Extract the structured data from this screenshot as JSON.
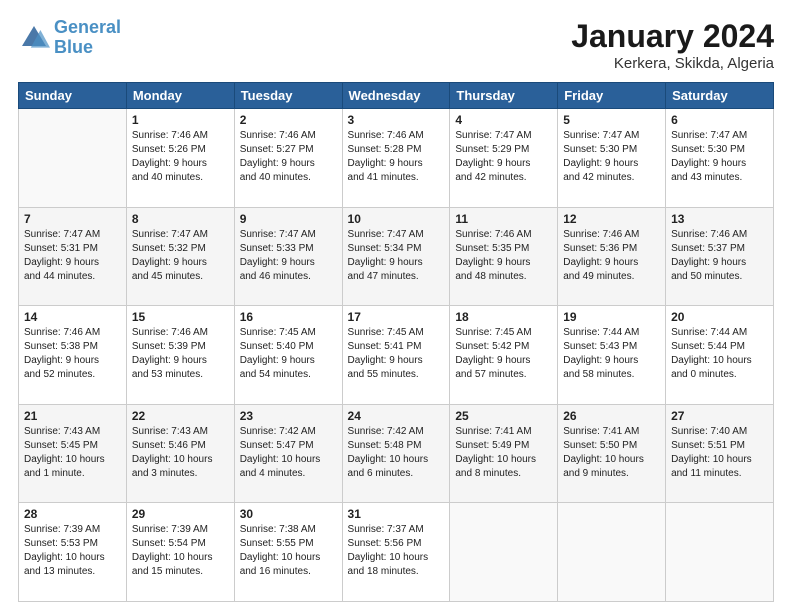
{
  "header": {
    "logo_line1": "General",
    "logo_line2": "Blue",
    "main_title": "January 2024",
    "subtitle": "Kerkera, Skikda, Algeria"
  },
  "days_of_week": [
    "Sunday",
    "Monday",
    "Tuesday",
    "Wednesday",
    "Thursday",
    "Friday",
    "Saturday"
  ],
  "weeks": [
    [
      {
        "day": "",
        "info": ""
      },
      {
        "day": "1",
        "info": "Sunrise: 7:46 AM\nSunset: 5:26 PM\nDaylight: 9 hours\nand 40 minutes."
      },
      {
        "day": "2",
        "info": "Sunrise: 7:46 AM\nSunset: 5:27 PM\nDaylight: 9 hours\nand 40 minutes."
      },
      {
        "day": "3",
        "info": "Sunrise: 7:46 AM\nSunset: 5:28 PM\nDaylight: 9 hours\nand 41 minutes."
      },
      {
        "day": "4",
        "info": "Sunrise: 7:47 AM\nSunset: 5:29 PM\nDaylight: 9 hours\nand 42 minutes."
      },
      {
        "day": "5",
        "info": "Sunrise: 7:47 AM\nSunset: 5:30 PM\nDaylight: 9 hours\nand 42 minutes."
      },
      {
        "day": "6",
        "info": "Sunrise: 7:47 AM\nSunset: 5:30 PM\nDaylight: 9 hours\nand 43 minutes."
      }
    ],
    [
      {
        "day": "7",
        "info": "Sunrise: 7:47 AM\nSunset: 5:31 PM\nDaylight: 9 hours\nand 44 minutes."
      },
      {
        "day": "8",
        "info": "Sunrise: 7:47 AM\nSunset: 5:32 PM\nDaylight: 9 hours\nand 45 minutes."
      },
      {
        "day": "9",
        "info": "Sunrise: 7:47 AM\nSunset: 5:33 PM\nDaylight: 9 hours\nand 46 minutes."
      },
      {
        "day": "10",
        "info": "Sunrise: 7:47 AM\nSunset: 5:34 PM\nDaylight: 9 hours\nand 47 minutes."
      },
      {
        "day": "11",
        "info": "Sunrise: 7:46 AM\nSunset: 5:35 PM\nDaylight: 9 hours\nand 48 minutes."
      },
      {
        "day": "12",
        "info": "Sunrise: 7:46 AM\nSunset: 5:36 PM\nDaylight: 9 hours\nand 49 minutes."
      },
      {
        "day": "13",
        "info": "Sunrise: 7:46 AM\nSunset: 5:37 PM\nDaylight: 9 hours\nand 50 minutes."
      }
    ],
    [
      {
        "day": "14",
        "info": "Sunrise: 7:46 AM\nSunset: 5:38 PM\nDaylight: 9 hours\nand 52 minutes."
      },
      {
        "day": "15",
        "info": "Sunrise: 7:46 AM\nSunset: 5:39 PM\nDaylight: 9 hours\nand 53 minutes."
      },
      {
        "day": "16",
        "info": "Sunrise: 7:45 AM\nSunset: 5:40 PM\nDaylight: 9 hours\nand 54 minutes."
      },
      {
        "day": "17",
        "info": "Sunrise: 7:45 AM\nSunset: 5:41 PM\nDaylight: 9 hours\nand 55 minutes."
      },
      {
        "day": "18",
        "info": "Sunrise: 7:45 AM\nSunset: 5:42 PM\nDaylight: 9 hours\nand 57 minutes."
      },
      {
        "day": "19",
        "info": "Sunrise: 7:44 AM\nSunset: 5:43 PM\nDaylight: 9 hours\nand 58 minutes."
      },
      {
        "day": "20",
        "info": "Sunrise: 7:44 AM\nSunset: 5:44 PM\nDaylight: 10 hours\nand 0 minutes."
      }
    ],
    [
      {
        "day": "21",
        "info": "Sunrise: 7:43 AM\nSunset: 5:45 PM\nDaylight: 10 hours\nand 1 minute."
      },
      {
        "day": "22",
        "info": "Sunrise: 7:43 AM\nSunset: 5:46 PM\nDaylight: 10 hours\nand 3 minutes."
      },
      {
        "day": "23",
        "info": "Sunrise: 7:42 AM\nSunset: 5:47 PM\nDaylight: 10 hours\nand 4 minutes."
      },
      {
        "day": "24",
        "info": "Sunrise: 7:42 AM\nSunset: 5:48 PM\nDaylight: 10 hours\nand 6 minutes."
      },
      {
        "day": "25",
        "info": "Sunrise: 7:41 AM\nSunset: 5:49 PM\nDaylight: 10 hours\nand 8 minutes."
      },
      {
        "day": "26",
        "info": "Sunrise: 7:41 AM\nSunset: 5:50 PM\nDaylight: 10 hours\nand 9 minutes."
      },
      {
        "day": "27",
        "info": "Sunrise: 7:40 AM\nSunset: 5:51 PM\nDaylight: 10 hours\nand 11 minutes."
      }
    ],
    [
      {
        "day": "28",
        "info": "Sunrise: 7:39 AM\nSunset: 5:53 PM\nDaylight: 10 hours\nand 13 minutes."
      },
      {
        "day": "29",
        "info": "Sunrise: 7:39 AM\nSunset: 5:54 PM\nDaylight: 10 hours\nand 15 minutes."
      },
      {
        "day": "30",
        "info": "Sunrise: 7:38 AM\nSunset: 5:55 PM\nDaylight: 10 hours\nand 16 minutes."
      },
      {
        "day": "31",
        "info": "Sunrise: 7:37 AM\nSunset: 5:56 PM\nDaylight: 10 hours\nand 18 minutes."
      },
      {
        "day": "",
        "info": ""
      },
      {
        "day": "",
        "info": ""
      },
      {
        "day": "",
        "info": ""
      }
    ]
  ]
}
